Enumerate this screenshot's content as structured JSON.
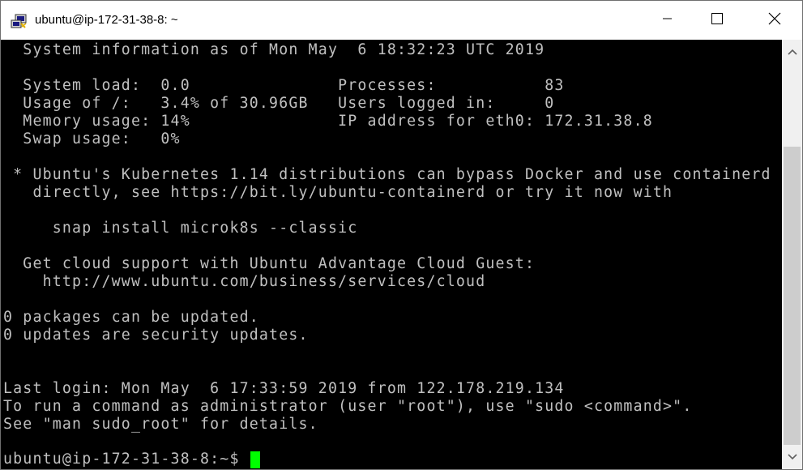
{
  "window": {
    "title": "ubuntu@ip-172-31-38-8: ~",
    "icons": {
      "app": "putty-icon",
      "minimize": "minimize-icon",
      "maximize": "maximize-icon",
      "close": "close-icon"
    }
  },
  "terminal": {
    "lines": [
      "  System information as of Mon May  6 18:32:23 UTC 2019",
      "",
      "  System load:  0.0               Processes:           83",
      "  Usage of /:   3.4% of 30.96GB   Users logged in:     0",
      "  Memory usage: 14%               IP address for eth0: 172.31.38.8",
      "  Swap usage:   0%",
      "",
      " * Ubuntu's Kubernetes 1.14 distributions can bypass Docker and use containerd",
      "   directly, see https://bit.ly/ubuntu-containerd or try it now with",
      "",
      "     snap install microk8s --classic",
      "",
      "  Get cloud support with Ubuntu Advantage Cloud Guest:",
      "    http://www.ubuntu.com/business/services/cloud",
      "",
      "0 packages can be updated.",
      "0 updates are security updates.",
      "",
      "",
      "Last login: Mon May  6 17:33:59 2019 from 122.178.219.134",
      "To run a command as administrator (user \"root\"), use \"sudo <command>\".",
      "See \"man sudo_root\" for details.",
      ""
    ],
    "prompt": "ubuntu@ip-172-31-38-8:~$",
    "colors": {
      "background": "#000000",
      "foreground": "#c0c0c0",
      "cursor": "#00ff00"
    }
  },
  "scrollbar": {
    "up_icon": "chevron-up-icon",
    "down_icon": "chevron-down-icon"
  }
}
